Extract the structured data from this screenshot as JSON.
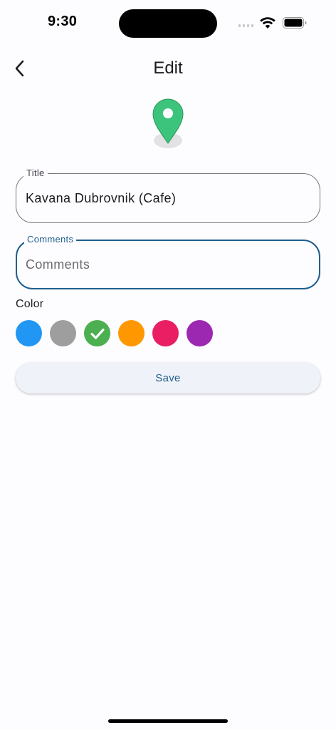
{
  "status_bar": {
    "time": "9:30"
  },
  "app_bar": {
    "title": "Edit",
    "back_icon": "chevron-left-icon"
  },
  "marker": {
    "icon": "map-marker-icon",
    "color": "#3cc47c"
  },
  "form": {
    "title_field": {
      "label": "Title",
      "value": "Kavana Dubrovnik (Cafe)"
    },
    "comments_field": {
      "label": "Comments",
      "value": "",
      "placeholder": "Comments"
    },
    "color_label": "Color",
    "colors": [
      {
        "name": "blue",
        "hex": "#2196f3",
        "selected": false
      },
      {
        "name": "grey",
        "hex": "#9e9e9e",
        "selected": false
      },
      {
        "name": "green",
        "hex": "#4caf50",
        "selected": true
      },
      {
        "name": "orange",
        "hex": "#ff9800",
        "selected": false
      },
      {
        "name": "pink",
        "hex": "#e91e63",
        "selected": false
      },
      {
        "name": "purple",
        "hex": "#9c27b0",
        "selected": false
      }
    ],
    "save_label": "Save"
  },
  "theme": {
    "accent": "#1f5f8f",
    "background": "#fdfcff"
  }
}
